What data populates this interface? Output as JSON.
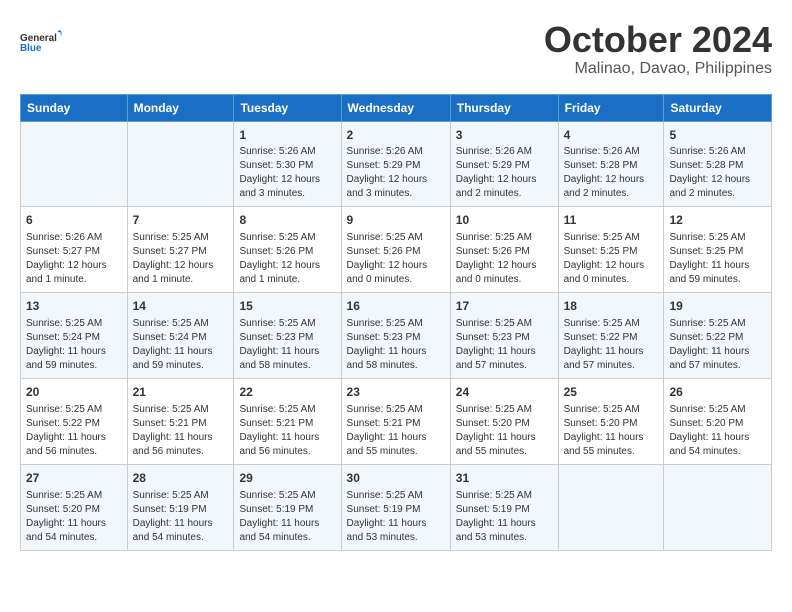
{
  "logo": {
    "line1": "General",
    "line2": "Blue"
  },
  "title": "October 2024",
  "subtitle": "Malinao, Davao, Philippines",
  "weekdays": [
    "Sunday",
    "Monday",
    "Tuesday",
    "Wednesday",
    "Thursday",
    "Friday",
    "Saturday"
  ],
  "weeks": [
    [
      {
        "day": "",
        "info": ""
      },
      {
        "day": "",
        "info": ""
      },
      {
        "day": "1",
        "info": "Sunrise: 5:26 AM\nSunset: 5:30 PM\nDaylight: 12 hours and 3 minutes."
      },
      {
        "day": "2",
        "info": "Sunrise: 5:26 AM\nSunset: 5:29 PM\nDaylight: 12 hours and 3 minutes."
      },
      {
        "day": "3",
        "info": "Sunrise: 5:26 AM\nSunset: 5:29 PM\nDaylight: 12 hours and 2 minutes."
      },
      {
        "day": "4",
        "info": "Sunrise: 5:26 AM\nSunset: 5:28 PM\nDaylight: 12 hours and 2 minutes."
      },
      {
        "day": "5",
        "info": "Sunrise: 5:26 AM\nSunset: 5:28 PM\nDaylight: 12 hours and 2 minutes."
      }
    ],
    [
      {
        "day": "6",
        "info": "Sunrise: 5:26 AM\nSunset: 5:27 PM\nDaylight: 12 hours and 1 minute."
      },
      {
        "day": "7",
        "info": "Sunrise: 5:25 AM\nSunset: 5:27 PM\nDaylight: 12 hours and 1 minute."
      },
      {
        "day": "8",
        "info": "Sunrise: 5:25 AM\nSunset: 5:26 PM\nDaylight: 12 hours and 1 minute."
      },
      {
        "day": "9",
        "info": "Sunrise: 5:25 AM\nSunset: 5:26 PM\nDaylight: 12 hours and 0 minutes."
      },
      {
        "day": "10",
        "info": "Sunrise: 5:25 AM\nSunset: 5:26 PM\nDaylight: 12 hours and 0 minutes."
      },
      {
        "day": "11",
        "info": "Sunrise: 5:25 AM\nSunset: 5:25 PM\nDaylight: 12 hours and 0 minutes."
      },
      {
        "day": "12",
        "info": "Sunrise: 5:25 AM\nSunset: 5:25 PM\nDaylight: 11 hours and 59 minutes."
      }
    ],
    [
      {
        "day": "13",
        "info": "Sunrise: 5:25 AM\nSunset: 5:24 PM\nDaylight: 11 hours and 59 minutes."
      },
      {
        "day": "14",
        "info": "Sunrise: 5:25 AM\nSunset: 5:24 PM\nDaylight: 11 hours and 59 minutes."
      },
      {
        "day": "15",
        "info": "Sunrise: 5:25 AM\nSunset: 5:23 PM\nDaylight: 11 hours and 58 minutes."
      },
      {
        "day": "16",
        "info": "Sunrise: 5:25 AM\nSunset: 5:23 PM\nDaylight: 11 hours and 58 minutes."
      },
      {
        "day": "17",
        "info": "Sunrise: 5:25 AM\nSunset: 5:23 PM\nDaylight: 11 hours and 57 minutes."
      },
      {
        "day": "18",
        "info": "Sunrise: 5:25 AM\nSunset: 5:22 PM\nDaylight: 11 hours and 57 minutes."
      },
      {
        "day": "19",
        "info": "Sunrise: 5:25 AM\nSunset: 5:22 PM\nDaylight: 11 hours and 57 minutes."
      }
    ],
    [
      {
        "day": "20",
        "info": "Sunrise: 5:25 AM\nSunset: 5:22 PM\nDaylight: 11 hours and 56 minutes."
      },
      {
        "day": "21",
        "info": "Sunrise: 5:25 AM\nSunset: 5:21 PM\nDaylight: 11 hours and 56 minutes."
      },
      {
        "day": "22",
        "info": "Sunrise: 5:25 AM\nSunset: 5:21 PM\nDaylight: 11 hours and 56 minutes."
      },
      {
        "day": "23",
        "info": "Sunrise: 5:25 AM\nSunset: 5:21 PM\nDaylight: 11 hours and 55 minutes."
      },
      {
        "day": "24",
        "info": "Sunrise: 5:25 AM\nSunset: 5:20 PM\nDaylight: 11 hours and 55 minutes."
      },
      {
        "day": "25",
        "info": "Sunrise: 5:25 AM\nSunset: 5:20 PM\nDaylight: 11 hours and 55 minutes."
      },
      {
        "day": "26",
        "info": "Sunrise: 5:25 AM\nSunset: 5:20 PM\nDaylight: 11 hours and 54 minutes."
      }
    ],
    [
      {
        "day": "27",
        "info": "Sunrise: 5:25 AM\nSunset: 5:20 PM\nDaylight: 11 hours and 54 minutes."
      },
      {
        "day": "28",
        "info": "Sunrise: 5:25 AM\nSunset: 5:19 PM\nDaylight: 11 hours and 54 minutes."
      },
      {
        "day": "29",
        "info": "Sunrise: 5:25 AM\nSunset: 5:19 PM\nDaylight: 11 hours and 54 minutes."
      },
      {
        "day": "30",
        "info": "Sunrise: 5:25 AM\nSunset: 5:19 PM\nDaylight: 11 hours and 53 minutes."
      },
      {
        "day": "31",
        "info": "Sunrise: 5:25 AM\nSunset: 5:19 PM\nDaylight: 11 hours and 53 minutes."
      },
      {
        "day": "",
        "info": ""
      },
      {
        "day": "",
        "info": ""
      }
    ]
  ]
}
